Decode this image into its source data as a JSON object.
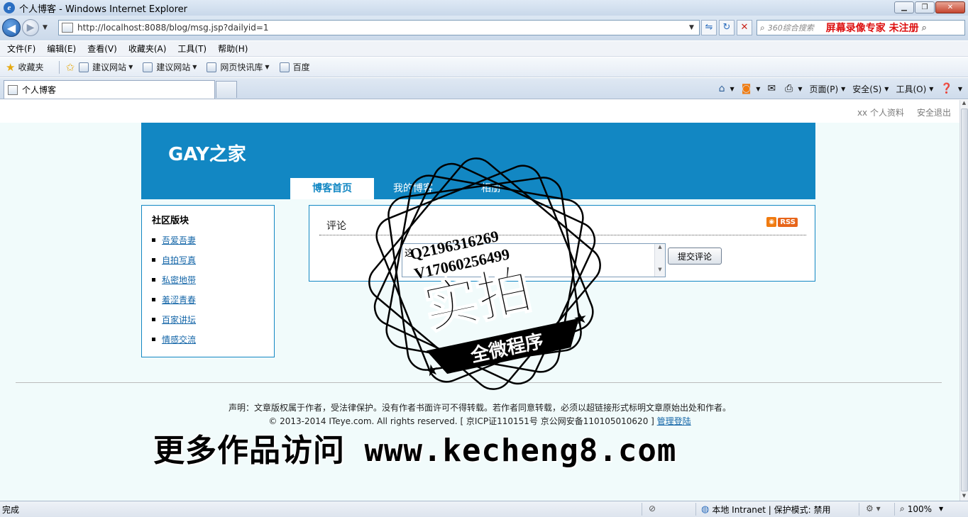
{
  "window": {
    "title": "个人博客 - Windows Internet Explorer",
    "min": "▁",
    "max": "❐",
    "close": "✕"
  },
  "address": {
    "url": "http://localhost:8088/blog/msg.jsp?dailyid=1",
    "search_placeholder": "360综合搜索",
    "search_brand": "屏幕录像专家 未注册"
  },
  "menu": [
    "文件(F)",
    "编辑(E)",
    "查看(V)",
    "收藏夹(A)",
    "工具(T)",
    "帮助(H)"
  ],
  "favorites": {
    "label": "收藏夹",
    "items": [
      "建议网站",
      "建议网站",
      "网页快讯库",
      "百度"
    ]
  },
  "tab": {
    "title": "个人博客"
  },
  "commandbar": {
    "page": "页面(P)",
    "safety": "安全(S)",
    "tools": "工具(O)"
  },
  "site": {
    "toplinks": [
      "xx 个人资料",
      "安全退出"
    ],
    "logo": "GAY之家",
    "nav": [
      "博客首页",
      "我的博客",
      "相册"
    ],
    "sidebar": {
      "title": "社区版块",
      "items": [
        "吾爱吾妻",
        "自拍写真",
        "私密地带",
        "羞涩青春",
        "百家讲坛",
        "情感交流"
      ]
    },
    "comment": {
      "title": "评论",
      "rss": "RSS",
      "textarea_value": "这",
      "submit": "提交评论"
    },
    "footer": {
      "line1": "声明：文章版权属于作者，受法律保护。没有作者书面许可不得转载。若作者同意转载，必须以超链接形式标明文章原始出处和作者。",
      "line2": "© 2013-2014 ITeye.com. All rights reserved. [ 京ICP证110151号 京公网安备110105010620 ]",
      "admin_link": "管理登陆"
    }
  },
  "watermark": {
    "qq": "Q2196316269",
    "v": "V17060256499",
    "big": "实拍",
    "banner": "全微程序",
    "url_text": "更多作品访问 www.kecheng8.com"
  },
  "status": {
    "text": "完成",
    "zone": "本地 Intranet | 保护模式: 禁用",
    "zoom": "100%"
  },
  "colors": {
    "brand_blue": "#1287c3",
    "page_bg": "#f1fbfb",
    "link": "#1466a8"
  }
}
